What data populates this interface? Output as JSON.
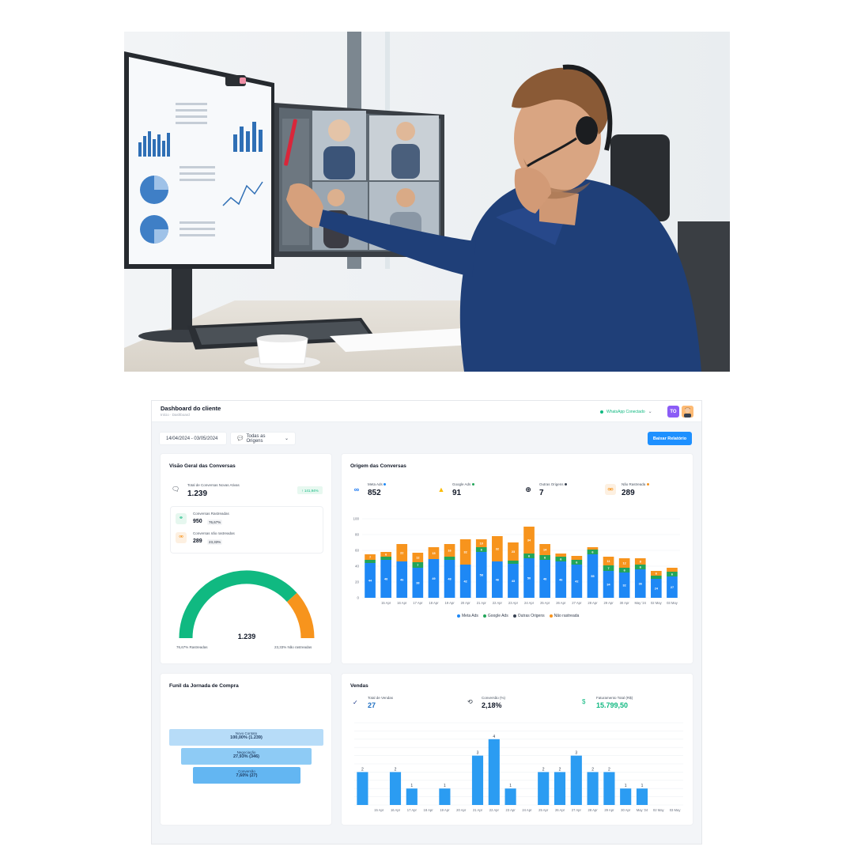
{
  "header": {
    "title": "Dashboard do cliente",
    "breadcrumb": "Início  ·  Dashboard",
    "whatsapp_status": "WhatsApp Conectado",
    "avatar_initials": "TO"
  },
  "filters": {
    "date_range": "14/04/2024 - 03/05/2024",
    "origin": "Todas as Origens",
    "report_button": "Baixar Relatório"
  },
  "overview": {
    "title": "Visão Geral das Conversas",
    "total_label": "Total de Conversas Novas Ativas",
    "total_value": "1.239",
    "badge": "↑ 141,94%",
    "tracked_label": "Conversas Rastreadas",
    "tracked_value": "950",
    "tracked_pct": "76,67%",
    "untracked_label": "Conversas não rastreadas",
    "untracked_value": "289",
    "untracked_pct": "23,33%",
    "gauge_value": "1.239",
    "gauge_left": "76,67% Rastreadas",
    "gauge_right": "23,33% Não rastreadas",
    "gauge_fraction": 0.7667
  },
  "origins": {
    "title": "Origem das Conversas",
    "items": [
      {
        "label": "Meta Ads",
        "value": "852"
      },
      {
        "label": "Google Ads",
        "value": "91"
      },
      {
        "label": "Outras Origens",
        "value": "7"
      },
      {
        "label": "Não Rastreada",
        "value": "289"
      }
    ],
    "legend": [
      "Meta Ads",
      "Google Ads",
      "Outras Origens",
      "Não rastreada"
    ]
  },
  "funnel": {
    "title": "Funil da Jornada de Compra",
    "stages": [
      {
        "label": "Novo Contato",
        "value": "100,00% (1.239)"
      },
      {
        "label": "Negociação",
        "value": "27,93% (346)"
      },
      {
        "label": "Conversão",
        "value": "7,60% (27)"
      }
    ]
  },
  "sales": {
    "title": "Vendas",
    "total_label": "Total de Vendas",
    "total_value": "27",
    "conv_label": "Conversão (%)",
    "conv_value": "2,18%",
    "revenue_label": "Faturamento Total (R$)",
    "revenue_value": "15.799,50"
  },
  "colors": {
    "meta": "#1e88f5",
    "google": "#22a559",
    "other": "#374151",
    "untracked": "#f7941d",
    "gauge_green": "#10b981",
    "gauge_orange": "#f7941d",
    "sales_bar": "#2b9cf2"
  },
  "chart_data": [
    {
      "type": "bar",
      "stacked": true,
      "categories": [
        "15 Apr",
        "16 Apr",
        "17 Apr",
        "18 Apr",
        "19 Apr",
        "20 Apr",
        "21 Apr",
        "22 Apr",
        "23 Apr",
        "24 Apr",
        "25 Apr",
        "26 Apr",
        "27 Apr",
        "28 Apr",
        "29 Apr",
        "30 Apr",
        "May '24",
        "02 May",
        "03 May"
      ],
      "series": [
        {
          "name": "Meta Ads",
          "values": [
            44,
            48,
            46,
            38,
            49,
            48,
            42,
            58,
            46,
            43,
            50,
            48,
            46,
            42,
            55,
            34,
            32,
            36,
            24,
            27
          ]
        },
        {
          "name": "Google Ads",
          "values": [
            4,
            4,
            0,
            7,
            0,
            4,
            0,
            6,
            0,
            4,
            6,
            6,
            6,
            6,
            6,
            7,
            6,
            6,
            4,
            6
          ]
        },
        {
          "name": "Outras Origens",
          "values": [
            0,
            0,
            0,
            0,
            0,
            0,
            0,
            0,
            0,
            0,
            0,
            0,
            0,
            0,
            0,
            0,
            0,
            0,
            0,
            0
          ]
        },
        {
          "name": "Não rastreada",
          "values": [
            7,
            6,
            22,
            12,
            15,
            16,
            32,
            10,
            32,
            23,
            34,
            14,
            4,
            5,
            3,
            11,
            12,
            8,
            6,
            5
          ]
        }
      ],
      "ylim": [
        0,
        100
      ],
      "yticks": [
        0,
        20,
        40,
        60,
        80,
        100
      ],
      "legend": "bottom"
    },
    {
      "type": "bar",
      "categories": [
        "15 Apr",
        "16 Apr",
        "17 Apr",
        "18 Apr",
        "19 Apr",
        "20 Apr",
        "21 Apr",
        "22 Apr",
        "23 Apr",
        "24 Apr",
        "25 Apr",
        "26 Apr",
        "27 Apr",
        "28 Apr",
        "29 Apr",
        "30 Apr",
        "May '24",
        "02 May",
        "03 May"
      ],
      "values": [
        2,
        0,
        2,
        1,
        0,
        1,
        0,
        3,
        4,
        1,
        0,
        2,
        2,
        3,
        2,
        2,
        1,
        1,
        0
      ],
      "ylim": [
        0,
        5
      ]
    }
  ]
}
